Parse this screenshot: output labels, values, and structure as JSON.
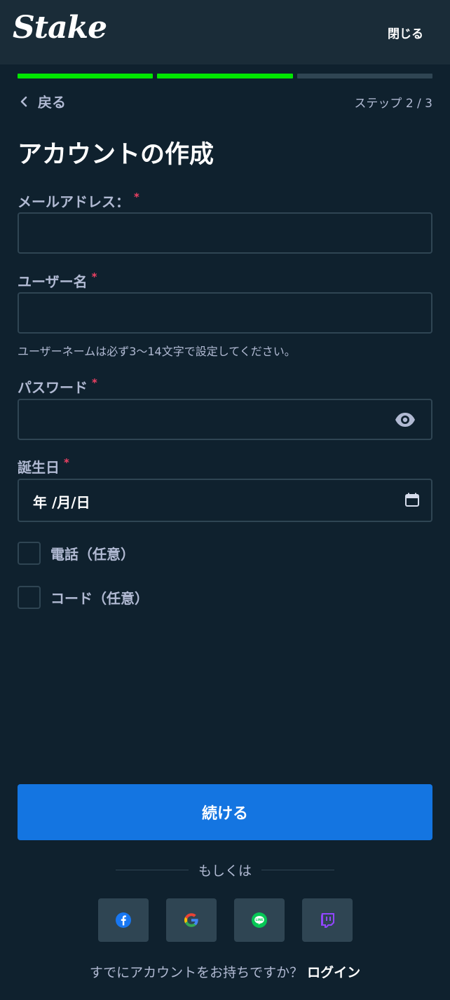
{
  "header": {
    "logo": "Stake",
    "close_label": "閉じる"
  },
  "progress": {
    "current_step": 2,
    "total_steps": 3
  },
  "nav": {
    "back_label": "戻る",
    "step_label": "ステップ 2 / 3"
  },
  "form": {
    "title": "アカウントの作成",
    "email": {
      "label": "メールアドレス：",
      "required": "*",
      "value": ""
    },
    "username": {
      "label": "ユーザー名",
      "required": "*",
      "value": "",
      "hint": "ユーザーネームは必ず3〜14文字で設定してください。"
    },
    "password": {
      "label": "パスワード",
      "required": "*",
      "value": ""
    },
    "birthdate": {
      "label": "誕生日",
      "required": "*",
      "value": "年 /月/日"
    },
    "phone_optional": {
      "label": "電話（任意）",
      "checked": false
    },
    "code_optional": {
      "label": "コード（任意）",
      "checked": false
    },
    "submit_label": "続ける"
  },
  "social": {
    "divider_text": "もしくは",
    "providers": [
      "facebook-icon",
      "google-icon",
      "line-icon",
      "twitch-icon"
    ]
  },
  "footer": {
    "prompt": "すでにアカウントをお持ちですか？",
    "login_label": "ログイン"
  },
  "colors": {
    "background": "#0f212e",
    "topbar": "#1a2c38",
    "accent_green": "#00e701",
    "button_blue": "#1475e1",
    "required_red": "#ed4163"
  }
}
